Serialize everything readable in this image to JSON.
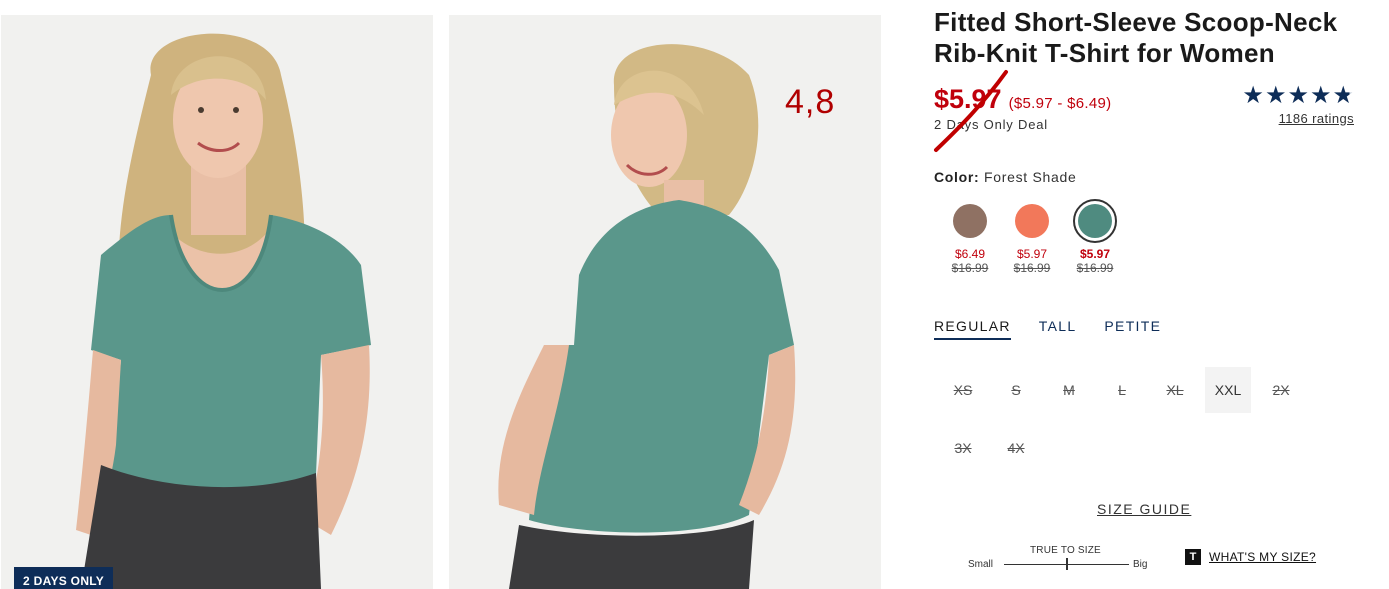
{
  "product": {
    "title": "Fitted Short-Sleeve Scoop-Neck Rib-Knit T-Shirt for Women",
    "price": "$5.97",
    "price_range": "($5.97 - $6.49)",
    "deal": "2 Days Only Deal",
    "rating_value": 4.8,
    "rating_count": "1186 ratings"
  },
  "images": {
    "badge": "2 DAYS ONLY",
    "overlay_number": "4,8"
  },
  "color": {
    "label": "Color:",
    "selected": "Forest Shade",
    "swatches": [
      {
        "name": "brown",
        "hex": "#8f7163",
        "price": "$6.49",
        "original": "$16.99"
      },
      {
        "name": "coral",
        "hex": "#f2785a",
        "price": "$5.97",
        "original": "$16.99"
      },
      {
        "name": "forest-shade",
        "hex": "#4f8b80",
        "price": "$5.97",
        "original": "$16.99"
      }
    ]
  },
  "fit_tabs": [
    "REGULAR",
    "TALL",
    "PETITE"
  ],
  "sizes": [
    {
      "label": "XS",
      "available": false
    },
    {
      "label": "S",
      "available": false
    },
    {
      "label": "M",
      "available": false
    },
    {
      "label": "L",
      "available": false
    },
    {
      "label": "XL",
      "available": false
    },
    {
      "label": "XXL",
      "available": true
    },
    {
      "label": "2X",
      "available": false
    },
    {
      "label": "3X",
      "available": false
    },
    {
      "label": "4X",
      "available": false
    }
  ],
  "size_guide": "SIZE GUIDE",
  "fit_scale": {
    "title": "TRUE TO SIZE",
    "small": "Small",
    "big": "Big"
  },
  "whats_my_size": {
    "icon": "T",
    "label": "WHAT'S MY SIZE?"
  },
  "colors": {
    "sale_red": "#c0000c",
    "navy": "#0e2d58",
    "shirt_green": "#5a978b",
    "strike_red": "#c00000"
  }
}
